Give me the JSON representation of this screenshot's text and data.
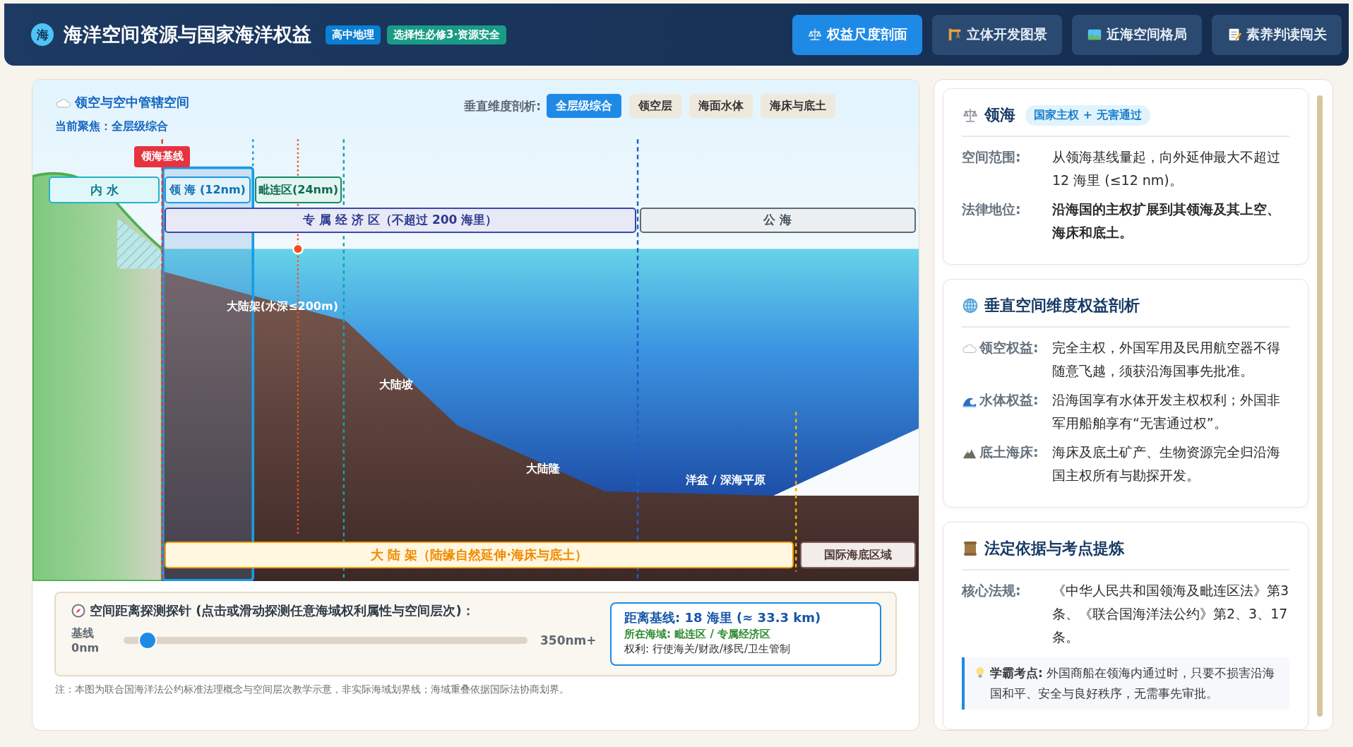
{
  "header": {
    "logo": "海",
    "title": "海洋空间资源与国家海洋权益",
    "tags": [
      {
        "label": "高中地理",
        "kind": "subject"
      },
      {
        "label": "选择性必修3·资源安全",
        "kind": "module"
      }
    ]
  },
  "nav_tabs": [
    {
      "label": "权益尺度剖面",
      "selected": true
    },
    {
      "label": "立体开发图景",
      "selected": false
    },
    {
      "label": "近海空间格局",
      "selected": false
    },
    {
      "label": "素养判读闯关",
      "selected": false
    }
  ],
  "diagram": {
    "title": "领空与空中管辖空间",
    "focus": "当前聚焦：全层级综合",
    "layer_label": "垂直维度剖析:",
    "layers": [
      {
        "label": "全层级综合",
        "selected": true
      },
      {
        "label": "领空层",
        "selected": false
      },
      {
        "label": "海面水体",
        "selected": false
      },
      {
        "label": "海床与底土",
        "selected": false
      }
    ],
    "baseline_badge": "领海基线",
    "zones": [
      {
        "label": "内 水"
      },
      {
        "label": "领 海 (12nm)"
      },
      {
        "label": "毗连区(24nm)"
      },
      {
        "label": "专 属 经 济 区（不超过 200 海里）"
      },
      {
        "label": "公 海"
      }
    ],
    "seabed_labels": [
      "大陆架(水深≤200m)",
      "大陆坡",
      "大陆隆",
      "洋盆 / 深海平原"
    ],
    "bottom_zones": [
      {
        "label": "大 陆 架（陆缘自然延伸·海床与底土）"
      },
      {
        "label": "国际海底区域"
      }
    ]
  },
  "probe": {
    "title": "空间距离探测探针 (点击或滑动探测任意海域权利属性与空间层次)：",
    "min_label": "基线",
    "min_value": "0nm",
    "max_label": "350nm+",
    "level": 0.06,
    "distance": "距离基线: 18 海里 (≈ 33.3 km)",
    "zone": "所在海域: 毗连区 / 专属经济区",
    "rights": "权利: 行使海关/财政/移民/卫生管制"
  },
  "note": "注：本图为联合国海洋法公约标准法理概念与空间层次教学示意，非实际海域划界线；海域重叠依据国际法协商划界。",
  "info_cards": [
    {
      "title": "领海",
      "tag": "国家主权 + 无害通过",
      "rows": [
        {
          "label": "空间范围:",
          "value": "从领海基线量起，向外延伸最大不超过 12 海里 (≤12 nm)。",
          "bold": false
        },
        {
          "label": "法律地位:",
          "value": "沿海国的主权扩展到其领海及其上空、海床和底土。",
          "bold": true
        }
      ]
    },
    {
      "title": "垂直空间维度权益剖析",
      "rows": [
        {
          "label": "领空权益:",
          "value": "完全主权，外国军用及民用航空器不得随意飞越，须获沿海国事先批准。",
          "bold": false
        },
        {
          "label": "水体权益:",
          "value": "沿海国享有水体开发主权权利；外国非军用船舶享有“无害通过权”。",
          "bold": false
        },
        {
          "label": "底土海床:",
          "value": "海床及底土矿产、生物资源完全归沿海国主权所有与勘探开发。",
          "bold": false
        }
      ]
    },
    {
      "title": "法定依据与考点提炼",
      "rows": [
        {
          "label": "核心法规:",
          "value": "《中华人民共和国领海及毗连区法》第3条、《联合国海洋法公约》第2、3、17条。",
          "bold": false
        }
      ],
      "tip": "**学霸考点:** 外国商船在领海内通过时，只要不损害沿海国和平、安全与良好秩序，无需事先审批。"
    }
  ]
}
